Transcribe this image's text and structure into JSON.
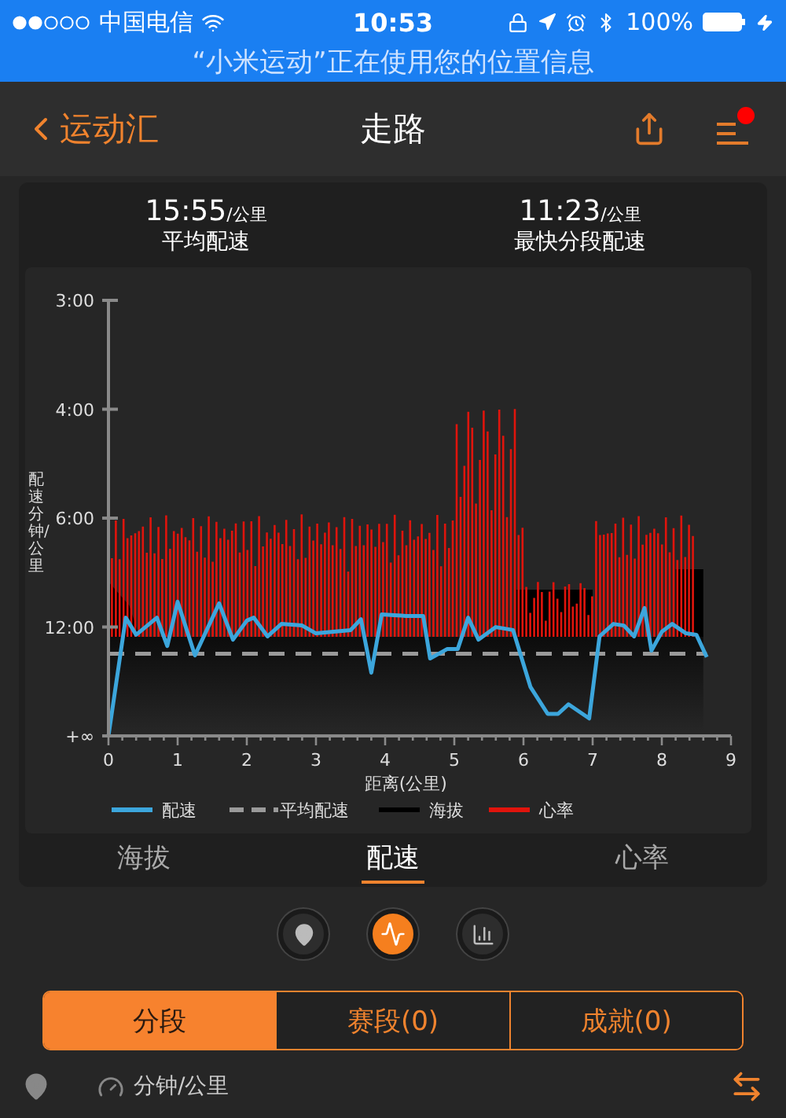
{
  "status_bar": {
    "carrier": "中国电信",
    "time": "10:53",
    "battery": "100%"
  },
  "location_banner": "“小米运动”正在使用您的位置信息",
  "nav": {
    "back": "运动汇",
    "title": "走路",
    "notification_dot": true
  },
  "stats": [
    {
      "value": "15:55",
      "unit": "/公里",
      "label": "平均配速"
    },
    {
      "value": "11:23",
      "unit": "/公里",
      "label": "最快分段配速"
    }
  ],
  "chart": {
    "ylabel": "配速分钟/公里",
    "xlabel": "距离(公里)",
    "yticks": [
      "3:00",
      "4:00",
      "6:00",
      "12:00",
      "+∞"
    ],
    "xticks": [
      "0",
      "1",
      "2",
      "3",
      "4",
      "5",
      "6",
      "7",
      "8",
      "9"
    ],
    "legend": [
      {
        "label": "配速",
        "kind": "solid",
        "color": "#3ca6dc"
      },
      {
        "label": "平均配速",
        "kind": "dashed",
        "color": "#9a9a9a"
      },
      {
        "label": "海拔",
        "kind": "solid",
        "color": "#000000"
      },
      {
        "label": "心率",
        "kind": "solid",
        "color": "#e0140c"
      }
    ]
  },
  "chart_tabs": [
    {
      "label": "海拔",
      "selected": false
    },
    {
      "label": "配速",
      "selected": true
    },
    {
      "label": "心率",
      "selected": false
    }
  ],
  "view_buttons": [
    {
      "kind": "map",
      "selected": false
    },
    {
      "kind": "wave",
      "selected": true
    },
    {
      "kind": "bars",
      "selected": false
    }
  ],
  "segments": [
    {
      "label": "分段",
      "selected": true
    },
    {
      "label": "赛段(0)",
      "selected": false
    },
    {
      "label": "成就(0)",
      "selected": false
    }
  ],
  "list_header": {
    "unit": "分钟/公里"
  }
}
